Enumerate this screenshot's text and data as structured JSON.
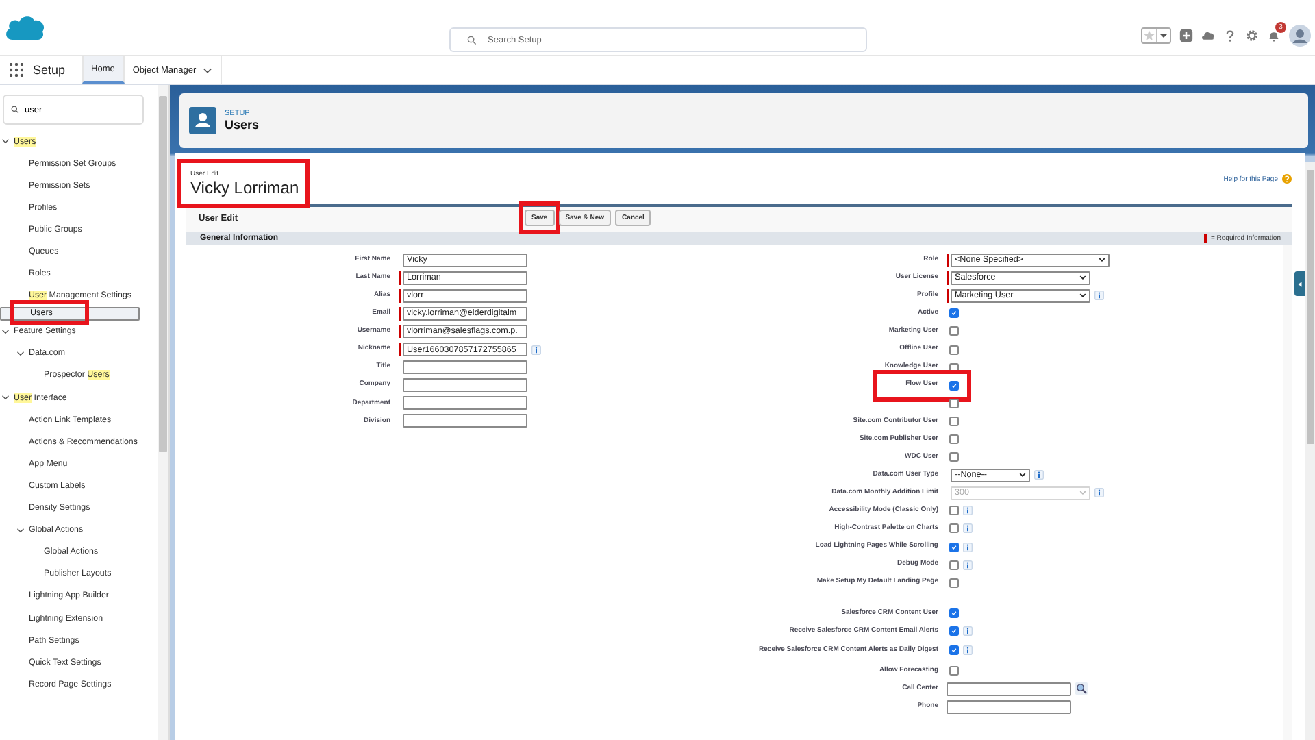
{
  "top_bar": {
    "search": {
      "placeholder": "Search Setup"
    },
    "notification_count": "3"
  },
  "nav": {
    "app_name": "Setup",
    "tabs": [
      {
        "label": "Home",
        "selected": true,
        "menu": false
      },
      {
        "label": "Object Manager",
        "selected": false,
        "menu": true
      }
    ]
  },
  "sidebar": {
    "search": {
      "value": "user"
    },
    "items": [
      {
        "parts": [
          {
            "text": "Users",
            "match": true
          }
        ],
        "selected": false,
        "expanded": true,
        "children": [
          {
            "parts": [
              {
                "text": "Permission Set Groups",
                "match": false
              }
            ],
            "selected": false
          },
          {
            "parts": [
              {
                "text": "Permission Sets",
                "match": false
              }
            ],
            "selected": false
          },
          {
            "parts": [
              {
                "text": "Profiles",
                "match": false
              }
            ],
            "selected": false
          },
          {
            "parts": [
              {
                "text": "Public Groups",
                "match": false
              }
            ],
            "selected": false
          },
          {
            "parts": [
              {
                "text": "Queues",
                "match": false
              }
            ],
            "selected": false
          },
          {
            "parts": [
              {
                "text": "Roles",
                "match": false
              }
            ],
            "selected": false
          },
          {
            "parts": [
              {
                "text": "User",
                "match": true
              },
              {
                "text": " Management Settings",
                "match": false
              }
            ],
            "selected": false
          },
          {
            "parts": [
              {
                "text": "Users",
                "match": false
              }
            ],
            "selected": true,
            "highlighted": true
          }
        ]
      },
      {
        "parts": [
          {
            "text": "Feature Settings",
            "match": false
          }
        ],
        "selected": false,
        "expanded": true,
        "children": [
          {
            "parts": [
              {
                "text": "Data.com",
                "match": false
              }
            ],
            "selected": false,
            "expanded": true,
            "children": [
              {
                "parts": [
                  {
                    "text": "Prospector ",
                    "match": false
                  },
                  {
                    "text": "Users",
                    "match": true
                  }
                ],
                "selected": false
              }
            ]
          }
        ]
      },
      {
        "parts": [
          {
            "text": "User",
            "match": true
          },
          {
            "text": " Interface",
            "match": false
          }
        ],
        "selected": false,
        "expanded": true,
        "children": [
          {
            "parts": [
              {
                "text": "Action Link Templates",
                "match": false
              }
            ],
            "selected": false
          },
          {
            "parts": [
              {
                "text": "Actions & Recommendations",
                "match": false
              }
            ],
            "selected": false
          },
          {
            "parts": [
              {
                "text": "App Menu",
                "match": false
              }
            ],
            "selected": false
          },
          {
            "parts": [
              {
                "text": "Custom Labels",
                "match": false
              }
            ],
            "selected": false
          },
          {
            "parts": [
              {
                "text": "Density Settings",
                "match": false
              }
            ],
            "selected": false
          },
          {
            "parts": [
              {
                "text": "Global Actions",
                "match": false
              }
            ],
            "selected": false,
            "expanded": true,
            "children": [
              {
                "parts": [
                  {
                    "text": "Global Actions",
                    "match": false
                  }
                ],
                "selected": false
              },
              {
                "parts": [
                  {
                    "text": "Publisher Layouts",
                    "match": false
                  }
                ],
                "selected": false
              }
            ]
          },
          {
            "parts": [
              {
                "text": "Lightning App Builder",
                "match": false
              }
            ],
            "selected": false
          },
          {
            "parts": [
              {
                "text": "Lightning Extension",
                "match": false
              }
            ],
            "selected": false
          },
          {
            "parts": [
              {
                "text": "Path Settings",
                "match": false
              }
            ],
            "selected": false
          },
          {
            "parts": [
              {
                "text": "Quick Text Settings",
                "match": false
              }
            ],
            "selected": false
          },
          {
            "parts": [
              {
                "text": "Record Page Settings",
                "match": false
              }
            ],
            "selected": false
          }
        ]
      }
    ]
  },
  "page_header": {
    "eyebrow": "SETUP",
    "title": "Users"
  },
  "record": {
    "eyebrow": "User Edit",
    "title": "Vicky Lorriman",
    "highlighted": true,
    "help_link": "Help for this Page"
  },
  "edit_block": {
    "title": "User Edit",
    "buttons": [
      {
        "label": "Save",
        "highlighted": true
      },
      {
        "label": "Save & New",
        "highlighted": false
      },
      {
        "label": "Cancel",
        "highlighted": false
      }
    ]
  },
  "section": {
    "title": "General Information",
    "required_note": "= Required Information"
  },
  "left_fields": [
    {
      "label": "First Name",
      "value": "Vicky",
      "required": false,
      "info": false
    },
    {
      "label": "Last Name",
      "value": "Lorriman",
      "required": true,
      "info": false
    },
    {
      "label": "Alias",
      "value": "vlorr",
      "required": true,
      "info": false
    },
    {
      "label": "Email",
      "value": "vicky.lorriman@elderdigitalm",
      "required": true,
      "info": false
    },
    {
      "label": "Username",
      "value": "vlorriman@salesflags.com.p.",
      "required": true,
      "info": false
    },
    {
      "label": "Nickname",
      "value": "User1660307857172755865",
      "required": true,
      "info": true
    },
    {
      "label": "Title",
      "required": false,
      "info": false
    },
    {
      "label": "Company",
      "required": false,
      "info": false
    },
    {
      "label": "Department",
      "required": false,
      "info": false
    },
    {
      "label": "Division",
      "required": false,
      "info": false
    }
  ],
  "right_fields": [
    {
      "kind": "select",
      "label": "Role",
      "value": "<None Specified>",
      "required": true,
      "info": false,
      "disabled": false
    },
    {
      "kind": "select",
      "label": "User License",
      "value": "Salesforce",
      "required": true,
      "info": false,
      "disabled": false
    },
    {
      "kind": "select",
      "label": "Profile",
      "value": "Marketing User",
      "required": true,
      "info": true,
      "disabled": false
    },
    {
      "kind": "checkbox",
      "label": "Active",
      "checked": true,
      "info": false
    },
    {
      "kind": "checkbox",
      "label": "Marketing User",
      "checked": false,
      "info": false
    },
    {
      "kind": "checkbox",
      "label": "Offline User",
      "checked": false,
      "info": false
    },
    {
      "kind": "checkbox",
      "label": "Knowledge User",
      "checked": false,
      "info": false
    },
    {
      "kind": "checkbox",
      "label": "Flow User",
      "checked": true,
      "info": false,
      "highlighted": true
    },
    {
      "kind": "checkbox",
      "checked": false,
      "info": false
    },
    {
      "kind": "checkbox",
      "label": "Site.com Contributor User",
      "checked": false,
      "info": false
    },
    {
      "kind": "checkbox",
      "label": "Site.com Publisher User",
      "checked": false,
      "info": false
    },
    {
      "kind": "checkbox",
      "label": "WDC User",
      "checked": false,
      "info": false
    },
    {
      "kind": "select",
      "label": "Data.com User Type",
      "value": "--None--",
      "required": false,
      "info": true,
      "disabled": false
    },
    {
      "kind": "select",
      "label": "Data.com Monthly Addition Limit",
      "value": "300",
      "required": false,
      "info": true,
      "disabled": true
    },
    {
      "kind": "checkbox",
      "label": "Accessibility Mode (Classic Only)",
      "checked": false,
      "info": true
    },
    {
      "kind": "checkbox",
      "label": "High-Contrast Palette on Charts",
      "checked": false,
      "info": true
    },
    {
      "kind": "checkbox",
      "label": "Load Lightning Pages While Scrolling",
      "checked": true,
      "info": true
    },
    {
      "kind": "checkbox",
      "label": "Debug Mode",
      "checked": false,
      "info": true
    },
    {
      "kind": "checkbox",
      "label": "Make Setup My Default Landing Page",
      "checked": false,
      "info": false
    },
    {
      "kind": "spacer"
    },
    {
      "kind": "checkbox",
      "label": "Salesforce CRM Content User",
      "checked": true,
      "info": false
    },
    {
      "kind": "checkbox",
      "label": "Receive Salesforce CRM Content Email Alerts",
      "checked": true,
      "info": true
    },
    {
      "kind": "checkbox",
      "label": "Receive Salesforce CRM Content Alerts as Daily Digest",
      "checked": true,
      "info": true
    },
    {
      "kind": "checkbox",
      "label": "Allow Forecasting",
      "checked": false,
      "info": false
    },
    {
      "kind": "lookup",
      "label": "Call Center"
    },
    {
      "kind": "input",
      "label": "Phone"
    }
  ]
}
